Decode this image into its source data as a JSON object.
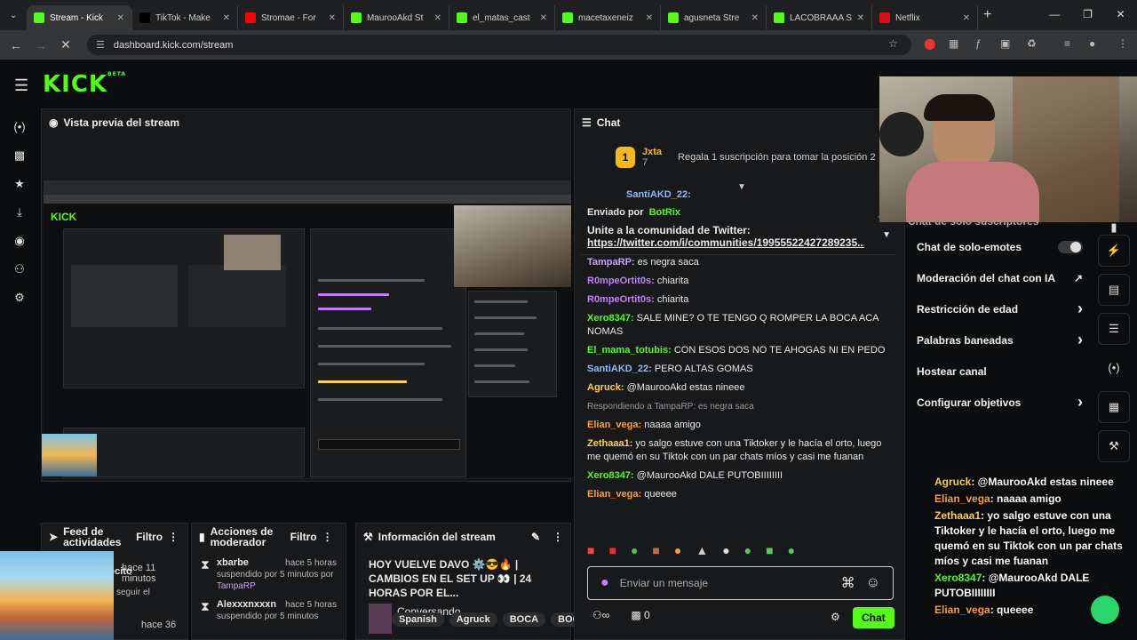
{
  "browser": {
    "tabs": [
      {
        "title": "Stream - Kick",
        "color": "#53fc18",
        "active": true
      },
      {
        "title": "TikTok - Make",
        "color": "#000000"
      },
      {
        "title": "Stromae - For",
        "color": "#ff0000"
      },
      {
        "title": "MauroоAkd St",
        "color": "#53fc18"
      },
      {
        "title": "el_matas_cast",
        "color": "#53fc18"
      },
      {
        "title": "macetaxeneiz",
        "color": "#53fc18"
      },
      {
        "title": "agusneta Stre",
        "color": "#53fc18"
      },
      {
        "title": "LACOBRAAA S",
        "color": "#53fc18"
      },
      {
        "title": "Netflix",
        "color": "#e50914"
      }
    ],
    "url": "dashboard.kick.com/stream"
  },
  "kick": {
    "logo": "KICK",
    "beta": "BETA"
  },
  "preview": {
    "title": "Vista previa del stream"
  },
  "chat": {
    "title": "Chat",
    "top_user": "Jxta",
    "top_rank": "1",
    "top_count": "7",
    "top_promo": "Regala 1 suscripción para tomar la posición 2",
    "cut_user": "SantiAKD_22:",
    "pinned_by_label": "Enviado por",
    "pinned_by": "BotRix",
    "pinned_text": "Unite a la comunidad de Twitter:",
    "pinned_link": "https://twitter.com/i/communities/19955522427289235...",
    "messages": [
      {
        "user": "TampaRP:",
        "text": "es negra saca",
        "color": "#c9a0ff"
      },
      {
        "user": "R0mpeOrtit0s:",
        "text": "chiarita",
        "color": "#c77dff"
      },
      {
        "user": "R0mpeOrtit0s:",
        "text": "chiarita",
        "color": "#c77dff"
      },
      {
        "user": "Xero8347:",
        "text": "SALE MINE? O TE TENGO Q ROMPER LA BOCA ACA NOMAS",
        "color": "#53fc18"
      },
      {
        "user": "El_mama_totubis:",
        "text": "CON ESOS DOS NO TE AHOGAS NI EN PEDO",
        "color": "#53fc18"
      },
      {
        "user": "SantiAKD_22:",
        "text": "PERO ALTAS GOMAS",
        "color": "#8fb8ff"
      },
      {
        "user": "Agruck:",
        "text": "@MaurooAkd estas nineee",
        "color": "#ffd24a"
      },
      {
        "reply": "Respondiendo a TampaRP: es negra saca"
      },
      {
        "user": "Elian_vega:",
        "text": "naaaa amigo",
        "color": "#ff9f2e"
      },
      {
        "user": "Zethaaa1:",
        "text": "yo salgo estuve con una Tiktoker y le hacía el orto, luego me quemó en su Tiktok con un par chats míos y casi me fuanan",
        "color": "#ffd24a"
      },
      {
        "user": "Xero8347:",
        "text": "@MaurooAkd DALE PUTOBIIIIIIII",
        "color": "#53fc18"
      },
      {
        "user": "Elian_vega:",
        "text": "queeee",
        "color": "#ff9f2e"
      }
    ],
    "input_placeholder": "Enviar un mensaje",
    "points": "0",
    "send_label": "Chat"
  },
  "settings": {
    "cut_label": "Chat de solo suscriptores",
    "rows": [
      {
        "label": "Chat de solo-emotes",
        "kind": "toggle"
      },
      {
        "label": "Moderación del chat con IA",
        "kind": "external"
      },
      {
        "label": "Restricción de edad",
        "kind": "arrow"
      },
      {
        "label": "Palabras baneadas",
        "kind": "arrow"
      },
      {
        "label": "Hostear canal",
        "kind": "none"
      },
      {
        "label": "Configurar objetivos",
        "kind": "arrow"
      }
    ]
  },
  "feed": {
    "title": "Feed de actividades",
    "filter": "Filtro",
    "partial": "ecito",
    "time1": "hace 11 minutos",
    "line1": "seguir el",
    "time2": "hace 36"
  },
  "mod": {
    "title": "Acciones de moderador",
    "filter": "Filtro",
    "items": [
      {
        "user": "xbarbe",
        "time": "hace 5 horas",
        "detail": "suspendido por 5 minutos por",
        "by": "TampaRP"
      },
      {
        "user": "Alexxxnxxxn",
        "time": "hace 5 horas",
        "detail": "suspendido por 5 minutos"
      }
    ]
  },
  "info": {
    "title": "Información del stream",
    "stream_title": "HOY VUELVE DAVO ⚙️😎🔥 | CAMBIOS EN EL SET UP 👀 | 24 HORAS POR EL...",
    "category": "Conversando",
    "tags": [
      "Spanish",
      "Agruck",
      "BOCA",
      "BOC"
    ]
  },
  "overlay": {
    "messages": [
      {
        "user": "Agruck",
        "text": ": @MaurooAkd estas nineee",
        "color": "#ffd24a"
      },
      {
        "user": "Elian_vega",
        "text": ": naaaa amigo",
        "color": "#ff9f2e"
      },
      {
        "user": "Zethaaa1",
        "text": ": yo salgo estuve con una Tiktoker y le hacía el orto, luego me quemó en su Tiktok con un par chats míos y casi me fuanan",
        "color": "#ffd24a"
      },
      {
        "user": "Xero8347",
        "text": ": @MaurooAkd DALE PUTOBIIIIIIII",
        "color": "#53fc18"
      },
      {
        "user": "Elian_vega",
        "text": ": queeee",
        "color": "#ff9f2e"
      }
    ]
  },
  "colors": {
    "accent": "#53fc18",
    "panel": "#18191b",
    "bg": "#0b0d0e"
  }
}
